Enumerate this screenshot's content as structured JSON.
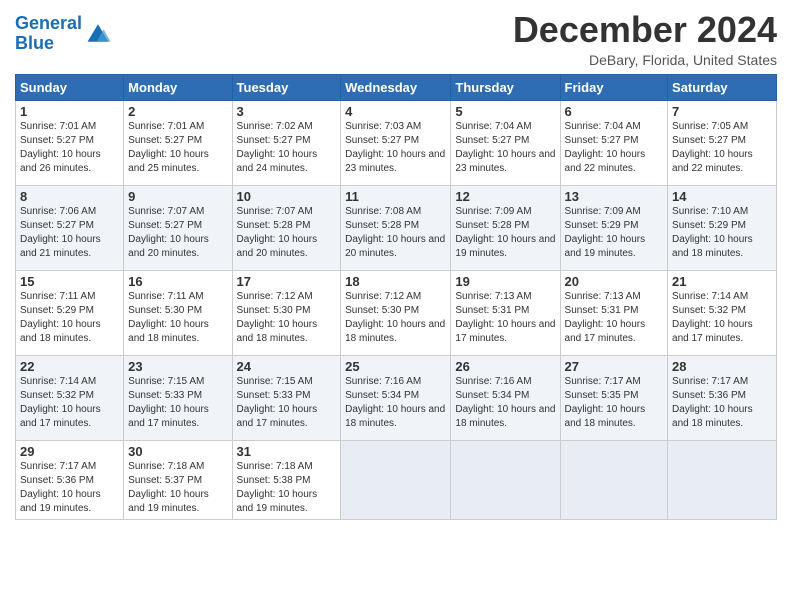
{
  "header": {
    "logo_line1": "General",
    "logo_line2": "Blue",
    "month_title": "December 2024",
    "location": "DeBary, Florida, United States"
  },
  "calendar": {
    "days_of_week": [
      "Sunday",
      "Monday",
      "Tuesday",
      "Wednesday",
      "Thursday",
      "Friday",
      "Saturday"
    ],
    "weeks": [
      [
        {
          "day": "1",
          "sunrise": "7:01 AM",
          "sunset": "5:27 PM",
          "daylight": "10 hours and 26 minutes."
        },
        {
          "day": "2",
          "sunrise": "7:01 AM",
          "sunset": "5:27 PM",
          "daylight": "10 hours and 25 minutes."
        },
        {
          "day": "3",
          "sunrise": "7:02 AM",
          "sunset": "5:27 PM",
          "daylight": "10 hours and 24 minutes."
        },
        {
          "day": "4",
          "sunrise": "7:03 AM",
          "sunset": "5:27 PM",
          "daylight": "10 hours and 23 minutes."
        },
        {
          "day": "5",
          "sunrise": "7:04 AM",
          "sunset": "5:27 PM",
          "daylight": "10 hours and 23 minutes."
        },
        {
          "day": "6",
          "sunrise": "7:04 AM",
          "sunset": "5:27 PM",
          "daylight": "10 hours and 22 minutes."
        },
        {
          "day": "7",
          "sunrise": "7:05 AM",
          "sunset": "5:27 PM",
          "daylight": "10 hours and 22 minutes."
        }
      ],
      [
        {
          "day": "8",
          "sunrise": "7:06 AM",
          "sunset": "5:27 PM",
          "daylight": "10 hours and 21 minutes."
        },
        {
          "day": "9",
          "sunrise": "7:07 AM",
          "sunset": "5:27 PM",
          "daylight": "10 hours and 20 minutes."
        },
        {
          "day": "10",
          "sunrise": "7:07 AM",
          "sunset": "5:28 PM",
          "daylight": "10 hours and 20 minutes."
        },
        {
          "day": "11",
          "sunrise": "7:08 AM",
          "sunset": "5:28 PM",
          "daylight": "10 hours and 20 minutes."
        },
        {
          "day": "12",
          "sunrise": "7:09 AM",
          "sunset": "5:28 PM",
          "daylight": "10 hours and 19 minutes."
        },
        {
          "day": "13",
          "sunrise": "7:09 AM",
          "sunset": "5:29 PM",
          "daylight": "10 hours and 19 minutes."
        },
        {
          "day": "14",
          "sunrise": "7:10 AM",
          "sunset": "5:29 PM",
          "daylight": "10 hours and 18 minutes."
        }
      ],
      [
        {
          "day": "15",
          "sunrise": "7:11 AM",
          "sunset": "5:29 PM",
          "daylight": "10 hours and 18 minutes."
        },
        {
          "day": "16",
          "sunrise": "7:11 AM",
          "sunset": "5:30 PM",
          "daylight": "10 hours and 18 minutes."
        },
        {
          "day": "17",
          "sunrise": "7:12 AM",
          "sunset": "5:30 PM",
          "daylight": "10 hours and 18 minutes."
        },
        {
          "day": "18",
          "sunrise": "7:12 AM",
          "sunset": "5:30 PM",
          "daylight": "10 hours and 18 minutes."
        },
        {
          "day": "19",
          "sunrise": "7:13 AM",
          "sunset": "5:31 PM",
          "daylight": "10 hours and 17 minutes."
        },
        {
          "day": "20",
          "sunrise": "7:13 AM",
          "sunset": "5:31 PM",
          "daylight": "10 hours and 17 minutes."
        },
        {
          "day": "21",
          "sunrise": "7:14 AM",
          "sunset": "5:32 PM",
          "daylight": "10 hours and 17 minutes."
        }
      ],
      [
        {
          "day": "22",
          "sunrise": "7:14 AM",
          "sunset": "5:32 PM",
          "daylight": "10 hours and 17 minutes."
        },
        {
          "day": "23",
          "sunrise": "7:15 AM",
          "sunset": "5:33 PM",
          "daylight": "10 hours and 17 minutes."
        },
        {
          "day": "24",
          "sunrise": "7:15 AM",
          "sunset": "5:33 PM",
          "daylight": "10 hours and 17 minutes."
        },
        {
          "day": "25",
          "sunrise": "7:16 AM",
          "sunset": "5:34 PM",
          "daylight": "10 hours and 18 minutes."
        },
        {
          "day": "26",
          "sunrise": "7:16 AM",
          "sunset": "5:34 PM",
          "daylight": "10 hours and 18 minutes."
        },
        {
          "day": "27",
          "sunrise": "7:17 AM",
          "sunset": "5:35 PM",
          "daylight": "10 hours and 18 minutes."
        },
        {
          "day": "28",
          "sunrise": "7:17 AM",
          "sunset": "5:36 PM",
          "daylight": "10 hours and 18 minutes."
        }
      ],
      [
        {
          "day": "29",
          "sunrise": "7:17 AM",
          "sunset": "5:36 PM",
          "daylight": "10 hours and 19 minutes."
        },
        {
          "day": "30",
          "sunrise": "7:18 AM",
          "sunset": "5:37 PM",
          "daylight": "10 hours and 19 minutes."
        },
        {
          "day": "31",
          "sunrise": "7:18 AM",
          "sunset": "5:38 PM",
          "daylight": "10 hours and 19 minutes."
        },
        null,
        null,
        null,
        null
      ]
    ]
  }
}
